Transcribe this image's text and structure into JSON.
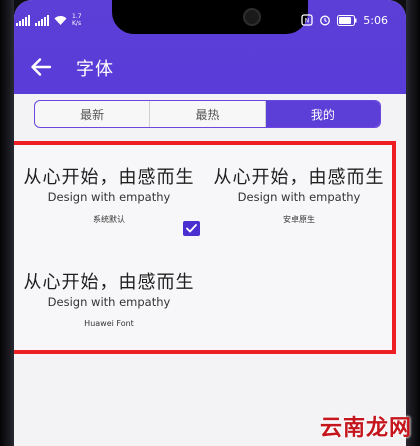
{
  "status_bar": {
    "carrier_left": "",
    "net_speed_top": "1.7",
    "net_speed_bottom": "K/s",
    "time": "5:06"
  },
  "header": {
    "title": "字体",
    "back_icon": "arrow-left-icon"
  },
  "tabs": [
    {
      "label": "最新",
      "active": false
    },
    {
      "label": "最热",
      "active": false
    },
    {
      "label": "我的",
      "active": true
    }
  ],
  "fonts": [
    {
      "sample": "从心开始，由感而生",
      "subtitle": "Design with empathy",
      "name": "系统默认",
      "selected": true
    },
    {
      "sample": "从心开始，由感而生",
      "subtitle": "Design with empathy",
      "name": "安卓原生",
      "selected": false
    },
    {
      "sample": "从心开始，由感而生",
      "subtitle": "Design with empathy",
      "name": "Huawei Font",
      "selected": false
    }
  ],
  "watermark": "云南龙网",
  "colors": {
    "accent": "#5b3fd6",
    "highlight": "#ee1d23",
    "watermark": "#c4161c"
  }
}
